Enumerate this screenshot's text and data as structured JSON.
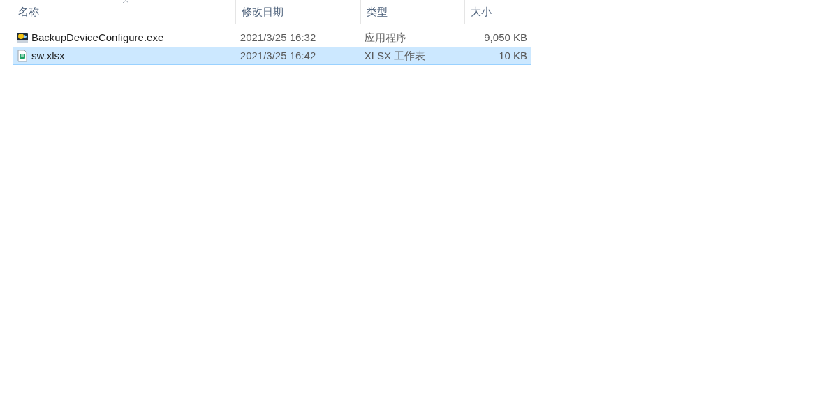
{
  "table": {
    "columns": [
      {
        "label": "名称",
        "sorted": true
      },
      {
        "label": "修改日期",
        "sorted": false
      },
      {
        "label": "类型",
        "sorted": false
      },
      {
        "label": "大小",
        "sorted": false
      }
    ],
    "rows": [
      {
        "kind": "exe",
        "selected": false,
        "cells": [
          "BackupDeviceConfigure.exe",
          "2021/3/25 16:32",
          "应用程序",
          "9,050 KB"
        ]
      },
      {
        "kind": "spreadsheet",
        "selected": true,
        "cells": [
          "sw.xlsx",
          "2021/3/25 16:42",
          "XLSX 工作表",
          "10 KB"
        ]
      }
    ]
  }
}
